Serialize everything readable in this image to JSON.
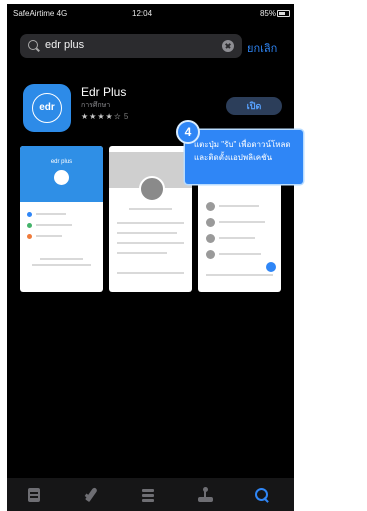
{
  "statusbar": {
    "carrier": "SafeAirtime 4G",
    "time": "12:04",
    "battery": "85%"
  },
  "search": {
    "query": "edr plus",
    "cancel_label": "ยกเลิก"
  },
  "app": {
    "icon_text": "edr",
    "name": "Edr Plus",
    "category": "การศึกษา",
    "stars": "★★★★☆",
    "rating_count": "5",
    "get_label": "เปิด"
  },
  "screenshots": {
    "ss1_title": "edr plus"
  },
  "callout": {
    "step": "4",
    "text": "แตะปุ่ม \"รับ\" เพื่อดาวน์โหลด และติดตั้งแอปพลิเคชัน"
  },
  "tabbar": {
    "icons": [
      "today-icon",
      "games-icon",
      "apps-icon",
      "arcade-icon",
      "search-icon"
    ],
    "active": "search",
    "accent": "#2f86f6"
  },
  "colors": {
    "accent": "#2f86f6",
    "app_icon": "#2d8be8",
    "background": "#000000"
  }
}
